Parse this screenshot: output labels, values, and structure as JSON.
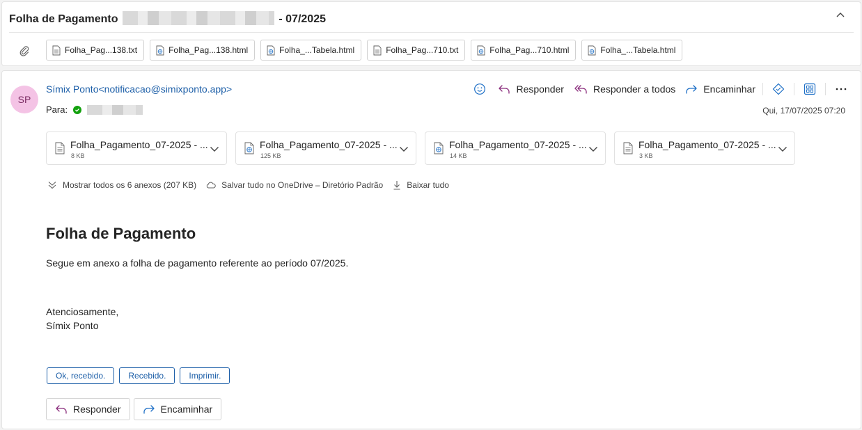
{
  "header": {
    "subject_prefix": "Folha de Pagamento",
    "subject_suffix": "- 07/2025"
  },
  "top_attachments": [
    {
      "name": "Folha_Pag...138.txt",
      "icon": "text-file-icon"
    },
    {
      "name": "Folha_Pag...138.html",
      "icon": "web-file-icon"
    },
    {
      "name": "Folha_...Tabela.html",
      "icon": "web-file-icon"
    },
    {
      "name": "Folha_Pag...710.txt",
      "icon": "text-file-icon"
    },
    {
      "name": "Folha_Pag...710.html",
      "icon": "web-file-icon"
    },
    {
      "name": "Folha_...Tabela.html",
      "icon": "web-file-icon"
    }
  ],
  "message": {
    "avatar_initials": "SP",
    "avatar_color": "#f4c3e5",
    "from": "Símix Ponto<notificacao@simixponto.app>",
    "to_label": "Para:",
    "date": "Qui, 17/07/2025 07:20"
  },
  "actions": {
    "reply": "Responder",
    "reply_all": "Responder a todos",
    "forward": "Encaminhar"
  },
  "attachments": [
    {
      "name": "Folha_Pagamento_07-2025 - ...",
      "size": "8 KB",
      "icon": "text-file-icon"
    },
    {
      "name": "Folha_Pagamento_07-2025 - ...",
      "size": "125 KB",
      "icon": "web-file-icon"
    },
    {
      "name": "Folha_Pagamento_07-2025 - ...",
      "size": "14 KB",
      "icon": "web-file-icon"
    },
    {
      "name": "Folha_Pagamento_07-2025 - ...",
      "size": "3 KB",
      "icon": "text-file-icon"
    }
  ],
  "attachment_links": {
    "show_all": "Mostrar todos os 6 anexos (207 KB)",
    "save_onedrive": "Salvar tudo no OneDrive – Diretório Padrão",
    "download_all": "Baixar tudo"
  },
  "body": {
    "title": "Folha de Pagamento",
    "text": "Segue em anexo a folha de pagamento referente ao período 07/2025.",
    "closing": "Atenciosamente,",
    "signature": "Símix Ponto"
  },
  "quick_replies": [
    "Ok, recebido.",
    "Recebido.",
    "Imprimir."
  ],
  "bottom_buttons": {
    "reply": "Responder",
    "forward": "Encaminhar"
  },
  "colors": {
    "accent": "#1d5fa8",
    "reply_icon": "#8b2e7d",
    "forward_icon": "#1d6fc6",
    "verified": "#13a10e"
  }
}
